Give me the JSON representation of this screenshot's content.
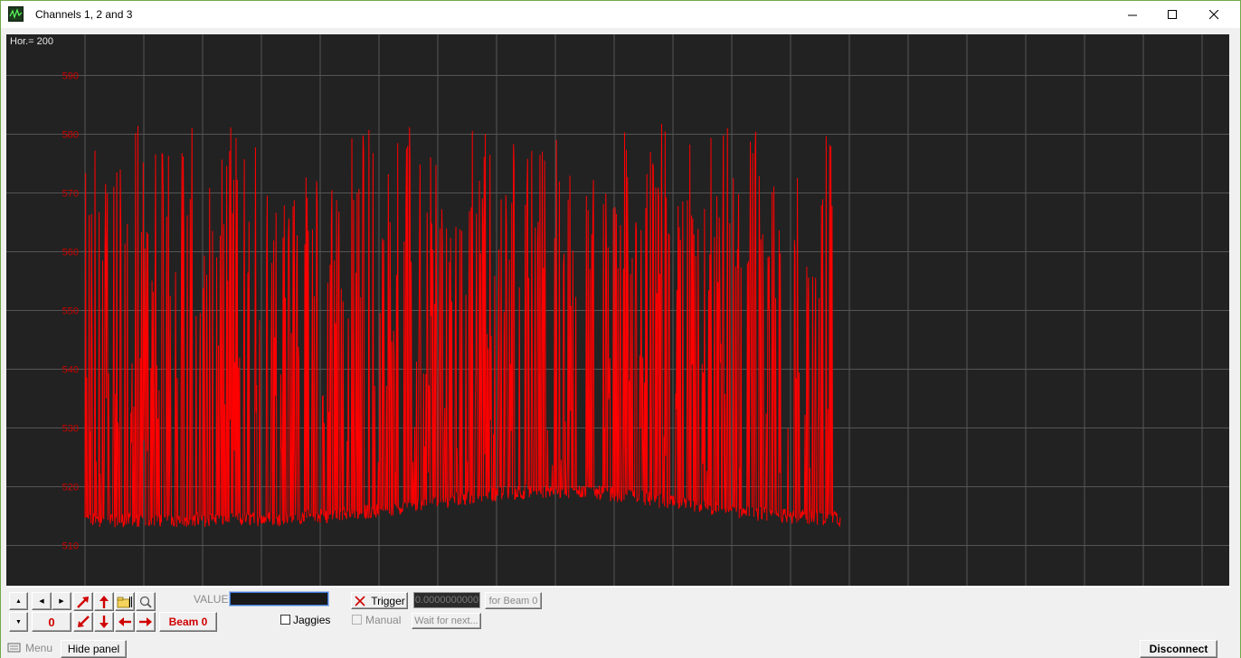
{
  "window": {
    "title": "Channels 1, 2 and 3",
    "controls": {
      "minimize": "—",
      "maximize": "☐",
      "close": "✕"
    }
  },
  "plot": {
    "hor_label": "Hor.= 200",
    "background": "#222222",
    "trace_color": "#ff0000",
    "tick_color": "#cc0000",
    "y_ticks": [
      "590",
      "580",
      "570",
      "560",
      "550",
      "540",
      "530",
      "520",
      "510"
    ]
  },
  "chart_data": {
    "type": "line",
    "series": [
      {
        "color": "#ff0000"
      }
    ],
    "ylim": [
      505,
      597
    ],
    "xlim": [
      0,
      2000
    ],
    "y_ticks": [
      510,
      520,
      530,
      540,
      550,
      560,
      570,
      580,
      590
    ],
    "x_data_range": [
      0,
      1285
    ],
    "baseline_range": [
      511,
      519
    ],
    "peak_range": [
      550,
      584
    ],
    "grid": true
  },
  "panel": {
    "up_small": "▲",
    "down_small": "▼",
    "left_small": "◀",
    "right_small": "▶",
    "counter": "0",
    "value_label": "VALUE:",
    "trigger_label": "Trigger",
    "trigger_value": "0.0000000000",
    "for_beam_label": "for Beam 0",
    "beam_button": "Beam 0",
    "jaggies_label": "Jaggies",
    "manual_label": "Manual",
    "wait_label": "Wait for next..."
  },
  "statusbar": {
    "menu_label": "Menu",
    "hide_panel_label": "Hide panel",
    "disconnect_label": "Disconnect"
  },
  "icons": {
    "app": "oscilloscope-icon",
    "folder": "folder-icon",
    "zoom": "magnifier-icon"
  }
}
